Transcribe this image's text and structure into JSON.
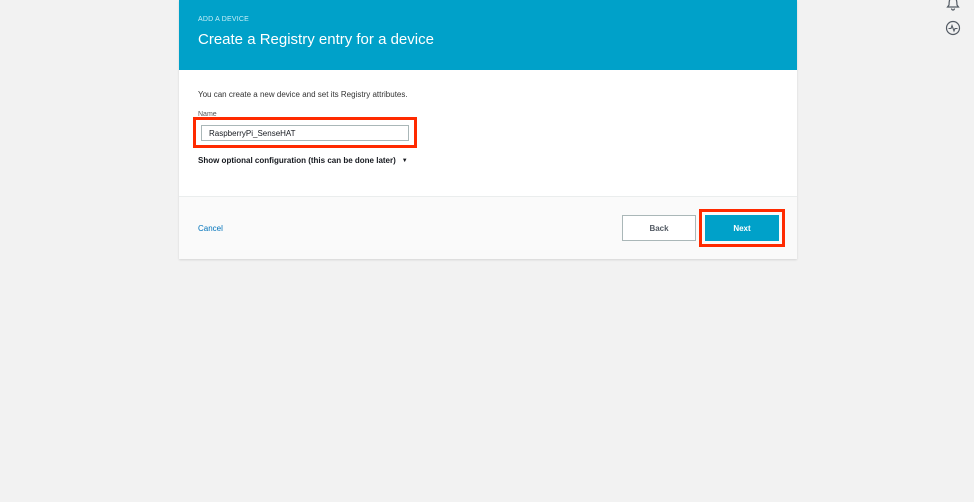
{
  "header": {
    "eyebrow": "ADD A DEVICE",
    "title": "Create a Registry entry for a device"
  },
  "body": {
    "intro": "You can create a new device and set its Registry attributes.",
    "name_label": "Name",
    "name_value": "RaspberryPi_SenseHAT",
    "optional_toggle": "Show optional configuration (this can be done later)"
  },
  "footer": {
    "cancel": "Cancel",
    "back": "Back",
    "next": "Next"
  },
  "icons": {
    "notifications": "bell-icon",
    "health": "activity-icon"
  },
  "colors": {
    "header_bg": "#00a1c9",
    "primary_button": "#00a1c9",
    "highlight": "#ff2a00",
    "link": "#0073bb"
  }
}
